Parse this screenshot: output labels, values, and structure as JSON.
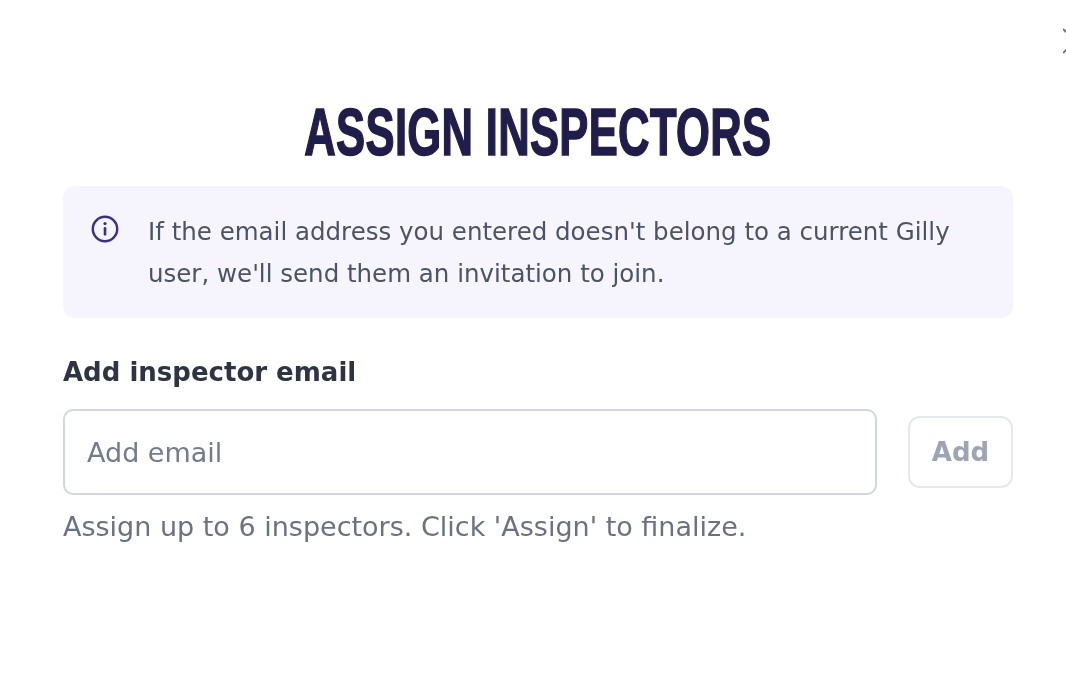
{
  "dialog": {
    "title": "ASSIGN INSPECTORS"
  },
  "notice": {
    "text": "If the email address you entered doesn't belong to a current Gilly user, we'll send them an invitation to join."
  },
  "field": {
    "label": "Add inspector email",
    "placeholder": "Add email"
  },
  "add_button": {
    "label": "Add",
    "disabled": true
  },
  "hint": "Assign up to 6 inspectors. Click 'Assign' to finalize."
}
